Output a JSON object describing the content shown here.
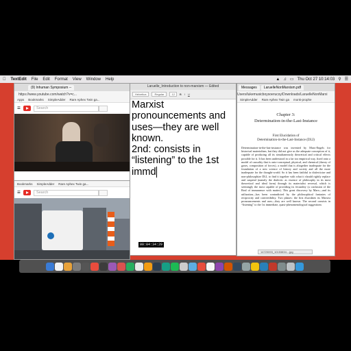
{
  "menubar": {
    "app": "TextEdit",
    "items": [
      "File",
      "Edit",
      "Format",
      "View",
      "Window",
      "Help"
    ],
    "clock": "Thu Oct 27  10:14:03"
  },
  "browser_top": {
    "tab1": "(9) Inhuman Symposium -- ",
    "url": "https://www.youtube.com/watch?v=c...",
    "bookmarks": [
      "Apps",
      "Bookmarks",
      "SimpleAdder",
      "Rare Aphex Twin ga..."
    ],
    "search_placeholder": "Search"
  },
  "browser_bottom": {
    "bookmarks": [
      "Bookmarks",
      "SimpleAdder",
      "Rare Aphex Twin ga..."
    ],
    "search_placeholder": "Search"
  },
  "textedit": {
    "title": "Laruelle_Introduction to non-marxism — Edited",
    "lines": [
      "Marxist",
      "pronouncements and",
      "uses—they are well",
      "known.",
      "2nd: consists in",
      "“listening” to the 1st",
      "immd"
    ],
    "timecode": "00:04:34:29"
  },
  "pdf": {
    "tabs": [
      "Messages",
      "LaruelleNonMarxism.pdf"
    ],
    "path": "Users/lukemusicboysoerucsy/Downloads/LaruelleNonMarxi",
    "bookmarks": [
      "SimpleAdder",
      "Rare Aphex Twin ga",
      "monk-prophe"
    ],
    "chapter": "Chapter 3:",
    "chapter_title": "Determination-in-the-Last-Instance",
    "section": "First Elucidation of",
    "section_title": "Determination-in-the-Last-Instance (DLI)",
    "paragraph": "Determination-in-the-last-instance was invented by Marx-Engels for historical materialism, but they did not give us the adequate conception of it, capable of producing all its simultaneously theoretical and critical effects possible for it. It has been understood in a far too empirical way, fixed onto a model of causality that is onto-conceptual, physical, and chemical (theory of gases, composition of forces), a model that is altogether inadequate for the foundation of a new science of history and society and all the more inadequate for the thought-world. So it has been faithful to dialecticize and non-philosophize DLI, to find it together with what it should rightly replace and suspend (namely the dialectic as essence of philosophy in its most theoretical and ideal form) through its materialist reversal, which is seemingly the most capable of providing its fecundity (a confusion of the Real of immanence with matter). This great discovery by Marx—and its utilization—has been contradicted by the philosophical fantasies of reciprocity and convertibility. Two phases: the first elucidates its Marxist pronouncements and uses—they are well known. The second consists in “listening” to the 1st immediate, quasi-phenomenological suggestions",
    "statusbar": "14720093_10153834....jpg"
  },
  "dock": {
    "colors": [
      "#3a7bd5",
      "#f2f2f2",
      "#e8a23a",
      "#7d7d7d",
      "#555555",
      "#e84c3d",
      "#3c3c3c",
      "#9b59b6",
      "#d9534f",
      "#27ae60",
      "#e9e9e9",
      "#f39c12",
      "#2c3e50",
      "#16a085",
      "#1db954",
      "#cccccc",
      "#5dade2",
      "#e74c3c",
      "#f5f5f5",
      "#8e44ad",
      "#d35400",
      "#34495e",
      "#95a5a6",
      "#f1c40f",
      "#2980b9",
      "#c0392b",
      "#7f8c8d",
      "#bdc3c7",
      "#3498db"
    ]
  }
}
